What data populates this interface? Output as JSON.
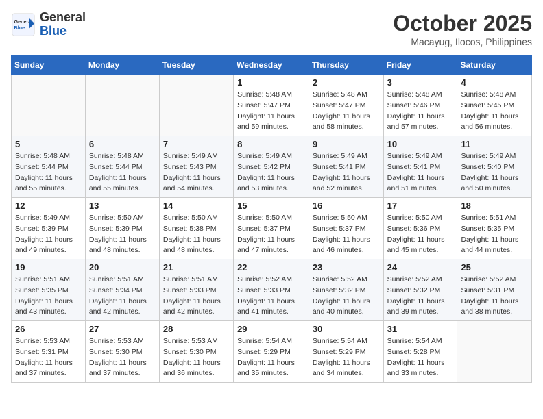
{
  "header": {
    "logo_general": "General",
    "logo_blue": "Blue",
    "month_title": "October 2025",
    "location": "Macayug, Ilocos, Philippines"
  },
  "weekdays": [
    "Sunday",
    "Monday",
    "Tuesday",
    "Wednesday",
    "Thursday",
    "Friday",
    "Saturday"
  ],
  "weeks": [
    [
      {
        "day": "",
        "sunrise": "",
        "sunset": "",
        "daylight": ""
      },
      {
        "day": "",
        "sunrise": "",
        "sunset": "",
        "daylight": ""
      },
      {
        "day": "",
        "sunrise": "",
        "sunset": "",
        "daylight": ""
      },
      {
        "day": "1",
        "sunrise": "Sunrise: 5:48 AM",
        "sunset": "Sunset: 5:47 PM",
        "daylight": "Daylight: 11 hours and 59 minutes."
      },
      {
        "day": "2",
        "sunrise": "Sunrise: 5:48 AM",
        "sunset": "Sunset: 5:47 PM",
        "daylight": "Daylight: 11 hours and 58 minutes."
      },
      {
        "day": "3",
        "sunrise": "Sunrise: 5:48 AM",
        "sunset": "Sunset: 5:46 PM",
        "daylight": "Daylight: 11 hours and 57 minutes."
      },
      {
        "day": "4",
        "sunrise": "Sunrise: 5:48 AM",
        "sunset": "Sunset: 5:45 PM",
        "daylight": "Daylight: 11 hours and 56 minutes."
      }
    ],
    [
      {
        "day": "5",
        "sunrise": "Sunrise: 5:48 AM",
        "sunset": "Sunset: 5:44 PM",
        "daylight": "Daylight: 11 hours and 55 minutes."
      },
      {
        "day": "6",
        "sunrise": "Sunrise: 5:48 AM",
        "sunset": "Sunset: 5:44 PM",
        "daylight": "Daylight: 11 hours and 55 minutes."
      },
      {
        "day": "7",
        "sunrise": "Sunrise: 5:49 AM",
        "sunset": "Sunset: 5:43 PM",
        "daylight": "Daylight: 11 hours and 54 minutes."
      },
      {
        "day": "8",
        "sunrise": "Sunrise: 5:49 AM",
        "sunset": "Sunset: 5:42 PM",
        "daylight": "Daylight: 11 hours and 53 minutes."
      },
      {
        "day": "9",
        "sunrise": "Sunrise: 5:49 AM",
        "sunset": "Sunset: 5:41 PM",
        "daylight": "Daylight: 11 hours and 52 minutes."
      },
      {
        "day": "10",
        "sunrise": "Sunrise: 5:49 AM",
        "sunset": "Sunset: 5:41 PM",
        "daylight": "Daylight: 11 hours and 51 minutes."
      },
      {
        "day": "11",
        "sunrise": "Sunrise: 5:49 AM",
        "sunset": "Sunset: 5:40 PM",
        "daylight": "Daylight: 11 hours and 50 minutes."
      }
    ],
    [
      {
        "day": "12",
        "sunrise": "Sunrise: 5:49 AM",
        "sunset": "Sunset: 5:39 PM",
        "daylight": "Daylight: 11 hours and 49 minutes."
      },
      {
        "day": "13",
        "sunrise": "Sunrise: 5:50 AM",
        "sunset": "Sunset: 5:39 PM",
        "daylight": "Daylight: 11 hours and 48 minutes."
      },
      {
        "day": "14",
        "sunrise": "Sunrise: 5:50 AM",
        "sunset": "Sunset: 5:38 PM",
        "daylight": "Daylight: 11 hours and 48 minutes."
      },
      {
        "day": "15",
        "sunrise": "Sunrise: 5:50 AM",
        "sunset": "Sunset: 5:37 PM",
        "daylight": "Daylight: 11 hours and 47 minutes."
      },
      {
        "day": "16",
        "sunrise": "Sunrise: 5:50 AM",
        "sunset": "Sunset: 5:37 PM",
        "daylight": "Daylight: 11 hours and 46 minutes."
      },
      {
        "day": "17",
        "sunrise": "Sunrise: 5:50 AM",
        "sunset": "Sunset: 5:36 PM",
        "daylight": "Daylight: 11 hours and 45 minutes."
      },
      {
        "day": "18",
        "sunrise": "Sunrise: 5:51 AM",
        "sunset": "Sunset: 5:35 PM",
        "daylight": "Daylight: 11 hours and 44 minutes."
      }
    ],
    [
      {
        "day": "19",
        "sunrise": "Sunrise: 5:51 AM",
        "sunset": "Sunset: 5:35 PM",
        "daylight": "Daylight: 11 hours and 43 minutes."
      },
      {
        "day": "20",
        "sunrise": "Sunrise: 5:51 AM",
        "sunset": "Sunset: 5:34 PM",
        "daylight": "Daylight: 11 hours and 42 minutes."
      },
      {
        "day": "21",
        "sunrise": "Sunrise: 5:51 AM",
        "sunset": "Sunset: 5:33 PM",
        "daylight": "Daylight: 11 hours and 42 minutes."
      },
      {
        "day": "22",
        "sunrise": "Sunrise: 5:52 AM",
        "sunset": "Sunset: 5:33 PM",
        "daylight": "Daylight: 11 hours and 41 minutes."
      },
      {
        "day": "23",
        "sunrise": "Sunrise: 5:52 AM",
        "sunset": "Sunset: 5:32 PM",
        "daylight": "Daylight: 11 hours and 40 minutes."
      },
      {
        "day": "24",
        "sunrise": "Sunrise: 5:52 AM",
        "sunset": "Sunset: 5:32 PM",
        "daylight": "Daylight: 11 hours and 39 minutes."
      },
      {
        "day": "25",
        "sunrise": "Sunrise: 5:52 AM",
        "sunset": "Sunset: 5:31 PM",
        "daylight": "Daylight: 11 hours and 38 minutes."
      }
    ],
    [
      {
        "day": "26",
        "sunrise": "Sunrise: 5:53 AM",
        "sunset": "Sunset: 5:31 PM",
        "daylight": "Daylight: 11 hours and 37 minutes."
      },
      {
        "day": "27",
        "sunrise": "Sunrise: 5:53 AM",
        "sunset": "Sunset: 5:30 PM",
        "daylight": "Daylight: 11 hours and 37 minutes."
      },
      {
        "day": "28",
        "sunrise": "Sunrise: 5:53 AM",
        "sunset": "Sunset: 5:30 PM",
        "daylight": "Daylight: 11 hours and 36 minutes."
      },
      {
        "day": "29",
        "sunrise": "Sunrise: 5:54 AM",
        "sunset": "Sunset: 5:29 PM",
        "daylight": "Daylight: 11 hours and 35 minutes."
      },
      {
        "day": "30",
        "sunrise": "Sunrise: 5:54 AM",
        "sunset": "Sunset: 5:29 PM",
        "daylight": "Daylight: 11 hours and 34 minutes."
      },
      {
        "day": "31",
        "sunrise": "Sunrise: 5:54 AM",
        "sunset": "Sunset: 5:28 PM",
        "daylight": "Daylight: 11 hours and 33 minutes."
      },
      {
        "day": "",
        "sunrise": "",
        "sunset": "",
        "daylight": ""
      }
    ]
  ]
}
